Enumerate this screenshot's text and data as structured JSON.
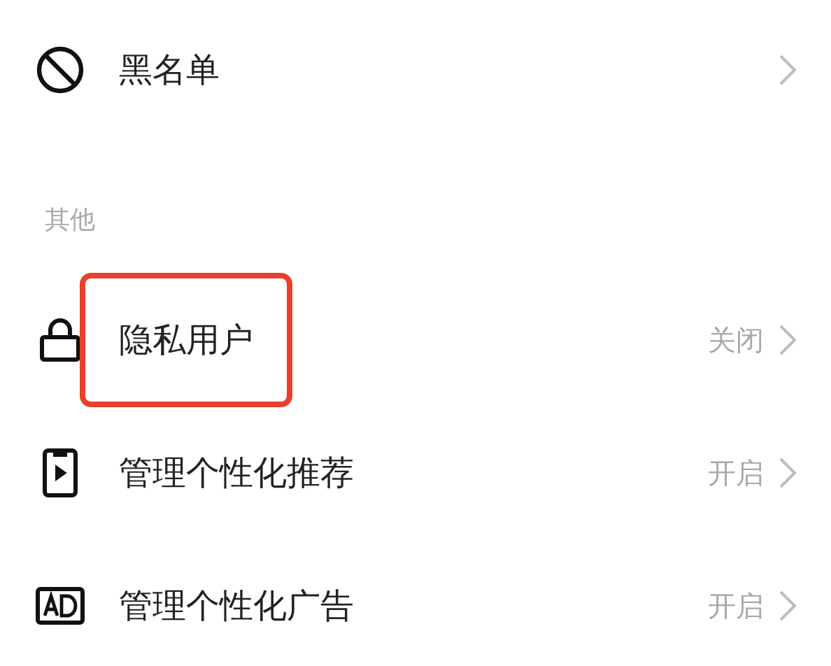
{
  "top_items": [
    {
      "kind": "block",
      "label": "黑名单",
      "highlighted": false
    }
  ],
  "sections": [
    {
      "title": "其他",
      "items": [
        {
          "kind": "lock",
          "label": "隐私用户",
          "value": "关闭",
          "highlighted": true
        },
        {
          "kind": "video",
          "label": "管理个性化推荐",
          "value": "开启",
          "highlighted": false
        },
        {
          "kind": "ad",
          "label": "管理个性化广告",
          "value": "开启",
          "highlighted": false
        }
      ]
    }
  ]
}
